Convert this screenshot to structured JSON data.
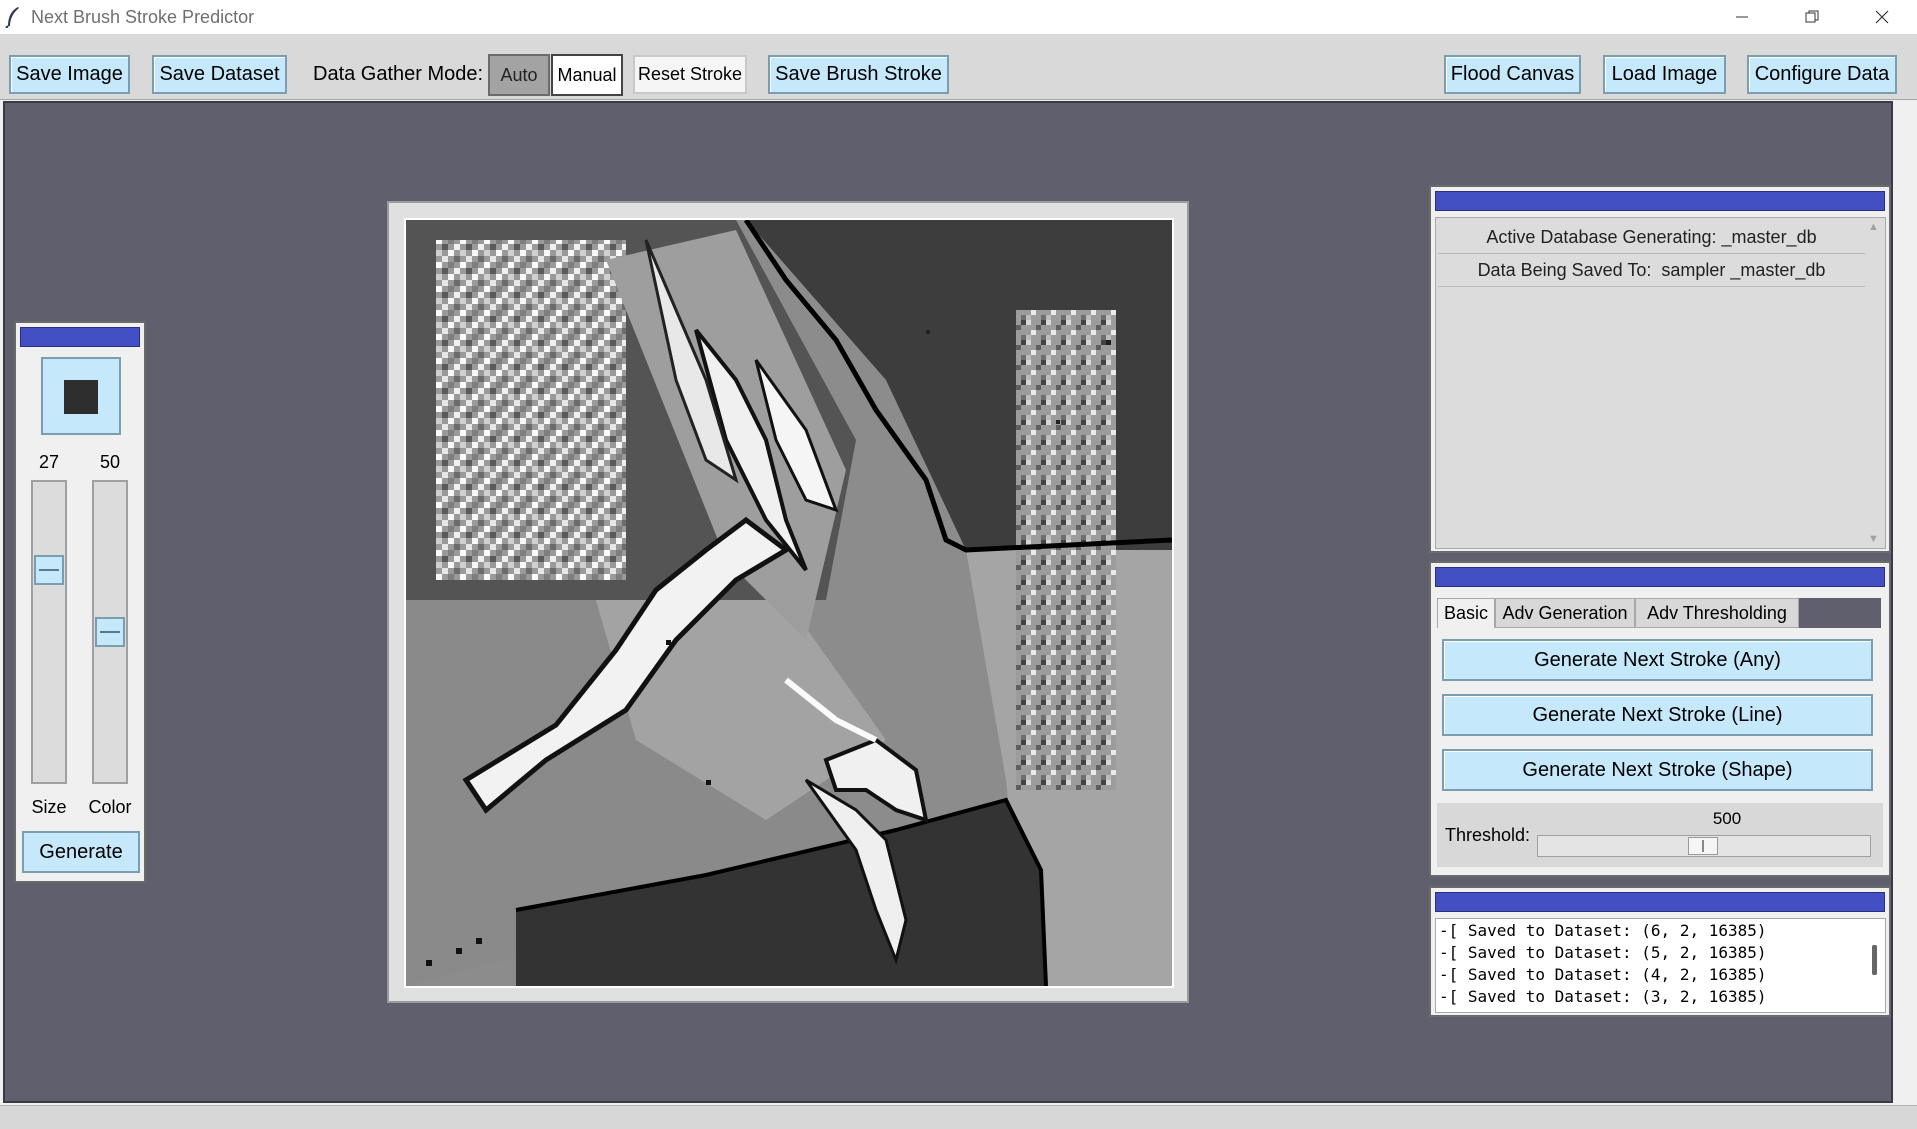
{
  "window": {
    "title": "Next Brush Stroke Predictor",
    "icon": "feather-icon",
    "controls": [
      "minimize-icon",
      "restore-icon",
      "close-icon"
    ]
  },
  "toolbar": {
    "save_image": "Save Image",
    "save_dataset": "Save Dataset",
    "gather_mode_label": "Data Gather Mode:",
    "mode_auto": "Auto",
    "mode_manual": "Manual",
    "selected_mode": "Manual",
    "reset_stroke": "Reset Stroke",
    "save_brush_stroke": "Save Brush Stroke",
    "flood_canvas": "Flood Canvas",
    "load_image": "Load Image",
    "configure_data": "Configure Data"
  },
  "brush_panel": {
    "swatch_color": "#2e2e2e",
    "size_value": "27",
    "color_value": "50",
    "size_label": "Size",
    "color_label": "Color",
    "size_level": 0.27,
    "color_level": 0.5,
    "generate": "Generate"
  },
  "database_panel": {
    "items": [
      "Active Database Generating: _master_db",
      "Data Being Saved To:  sampler _master_db"
    ]
  },
  "generation_panel": {
    "tabs": [
      "Basic",
      "Adv Generation",
      "Adv Thresholding"
    ],
    "active_tab": "Basic",
    "buttons": [
      "Generate Next Stroke (Any)",
      "Generate Next Stroke (Line)",
      "Generate Next Stroke (Shape)"
    ],
    "threshold_label": "Threshold:",
    "threshold_value": "500",
    "threshold_level": 0.5
  },
  "log_panel": {
    "lines": [
      "-[ Saved to Dataset: (6, 2, 16385)",
      "-[ Saved to Dataset: (5, 2, 16385)",
      "-[ Saved to Dataset: (4, 2, 16385)",
      "-[ Saved to Dataset: (3, 2, 16385)"
    ]
  },
  "colors": {
    "workspace": "#5f5f6d",
    "button": "#c6e8fb",
    "title_strip": "#4350c3"
  }
}
